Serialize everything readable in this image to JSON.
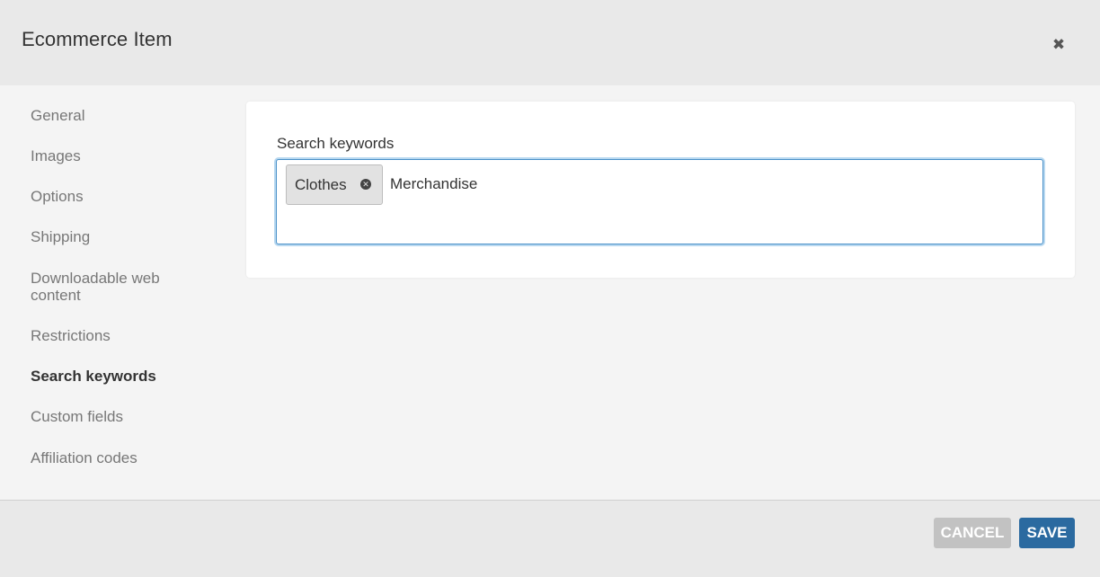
{
  "dialog": {
    "title": "Ecommerce Item",
    "close_glyph": "✖"
  },
  "sidebar": {
    "items": [
      {
        "label": "General",
        "active": false
      },
      {
        "label": "Images",
        "active": false
      },
      {
        "label": "Options",
        "active": false
      },
      {
        "label": "Shipping",
        "active": false
      },
      {
        "label": "Downloadable web content",
        "active": false
      },
      {
        "label": "Restrictions",
        "active": false
      },
      {
        "label": "Search keywords",
        "active": true
      },
      {
        "label": "Custom fields",
        "active": false
      },
      {
        "label": "Affiliation codes",
        "active": false
      }
    ]
  },
  "main": {
    "field_label": "Search keywords",
    "tags": [
      {
        "label": "Clothes",
        "remove_icon": "x-circle-icon"
      }
    ],
    "typed_value": "Merchandise",
    "remove_glyph": "✕"
  },
  "footer": {
    "cancel_label": "CANCEL",
    "save_label": "SAVE"
  },
  "colors": {
    "accent": "#2b6aa0",
    "focus_border": "#4a90c8",
    "cancel_bg": "#c2c2c2"
  }
}
